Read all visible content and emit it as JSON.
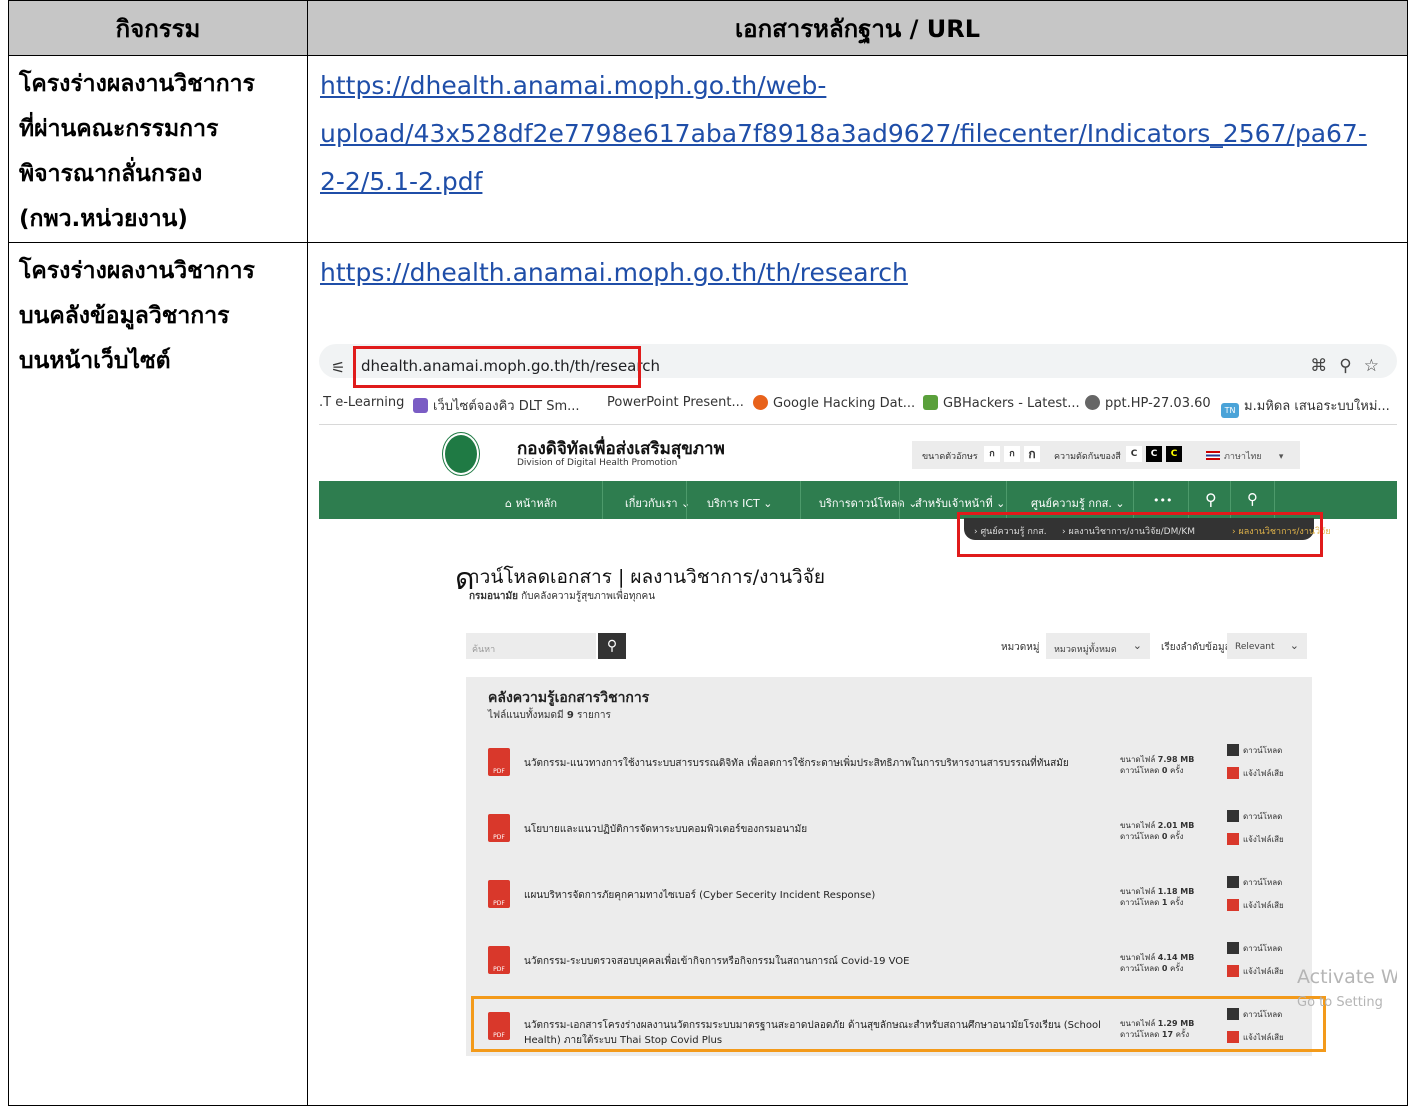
{
  "table": {
    "headers": [
      "กิจกรรม",
      "เอกสารหลักฐาน / URL"
    ],
    "rows": [
      {
        "activity_lines": [
          "โครงร่างผลงานวิชาการ",
          "ที่ผ่านคณะกรรมการ",
          "พิจารณากลั่นกรอง",
          "(กพว.หน่วยงาน)"
        ],
        "link_lines": [
          "https://dhealth.anamai.moph.go.th/web-",
          "upload/43x528df2e7798e617aba7f8918a3ad9627/filecenter/Indicators_2567/pa67-",
          "2-2/5.1-2.pdf"
        ]
      },
      {
        "activity_lines": [
          "โครงร่างผลงานวิชาการ",
          "บนคลังข้อมูลวิชาการ",
          "บนหน้าเว็บไซต์"
        ],
        "link": "https://dhealth.anamai.moph.go.th/th/research"
      }
    ]
  },
  "browser": {
    "url": "dhealth.anamai.moph.go.th/th/research",
    "bookmarks": [
      ".T e-Learning",
      "เว็บไซต์จองคิว DLT Sm...",
      "PowerPoint Present...",
      "Google Hacking Dat...",
      "GBHackers - Latest...",
      "ppt.HP-27.03.60",
      "ม.มหิดล เสนอระบบใหม่..."
    ],
    "bookmark_badge": "TN"
  },
  "site": {
    "name": "กองดิจิทัลเพื่อส่งเสริมสุขภาพ",
    "subname": "Division of Digital Health Promotion",
    "font_size_label": "ขนาดตัวอักษร",
    "font_sizes": [
      "ก",
      "ก",
      "ก"
    ],
    "contrast_label": "ความตัดกันของสี",
    "contrast": [
      "C",
      "C",
      "C"
    ],
    "language": "ภาษาไทย",
    "nav": [
      "หน้าหลัก",
      "เกี่ยวกับเรา ⌄",
      "บริการ ICT ⌄",
      "บริการดาวน์โหลด ⌄",
      "สำหรับเจ้าหน้าที่ ⌄",
      "ศูนย์ความรู้ กกส. ⌄",
      "•••"
    ],
    "breadcrumb": [
      "› ศูนย์ความรู้ กกส.",
      "› ผลงานวิชาการ/งานวิจัย/DM/KM",
      "› ผลงานวิชาการ/งานวิจัย"
    ],
    "page_title_letter": "ด",
    "page_title": "าวน์โหลดเอกสาร | ผลงานวิชาการ/งานวิจัย",
    "page_sub_bold": "กรมอนามัย",
    "page_sub": "กับคลังความรู้สุขภาพเพื่อทุกคน",
    "search_placeholder": "ค้นหา",
    "category_label": "หมวดหมู่",
    "category_value": "หมวดหมู่ทั้งหมด",
    "sort_label": "เรียงลำดับข้อมูล",
    "sort_value": "Relevant",
    "panel_title": "คลังความรู้เอกสารวิชาการ",
    "panel_count_prefix": "ไฟล์แนบทั้งหมดมี",
    "panel_count": "9",
    "panel_count_suffix": "รายการ",
    "download_label": "ดาวน์โหลด",
    "report_label": "แจ้งไฟล์เสีย",
    "size_label": "ขนาดไฟล์",
    "downloads_label": "ดาวน์โหลด",
    "times_label": "ครั้ง",
    "files": [
      {
        "name": "นวัตกรรม-แนวทางการใช้งานระบบสารบรรณดิจิทัล เพื่อลดการใช้กระดาษเพิ่มประสิทธิภาพในการบริหารงานสารบรรณที่ทันสมัย",
        "size": "7.98 MB",
        "downloads": "0"
      },
      {
        "name": "นโยบายและแนวปฏิบัติการจัดหาระบบคอมพิวเตอร์ของกรมอนามัย",
        "size": "2.01 MB",
        "downloads": "0"
      },
      {
        "name": "แผนบริหารจัดการภัยคุกคามทางไซเบอร์ (Cyber Secerity Incident Response)",
        "size": "1.18 MB",
        "downloads": "1"
      },
      {
        "name": "นวัตกรรม-ระบบตรวจสอบบุคคลเพื่อเข้ากิจการหรือกิจกรรมในสถานการณ์ Covid-19 VOE",
        "size": "4.14 MB",
        "downloads": "0"
      },
      {
        "name_line1": "นวัตกรรม-เอกสารโครงร่างผลงานนวัตกรรมระบบมาตรฐานสะอาดปลอดภัย ด้านสุขลักษณะสำหรับสถานศึกษาอนามัยโรงเรียน (School",
        "name_line2": "Health) ภายใต้ระบบ Thai Stop Covid Plus",
        "size": "1.29 MB",
        "downloads": "17"
      }
    ],
    "pdf_label": "PDF",
    "watermark1": "Activate W",
    "watermark2": "Go to Setting"
  }
}
